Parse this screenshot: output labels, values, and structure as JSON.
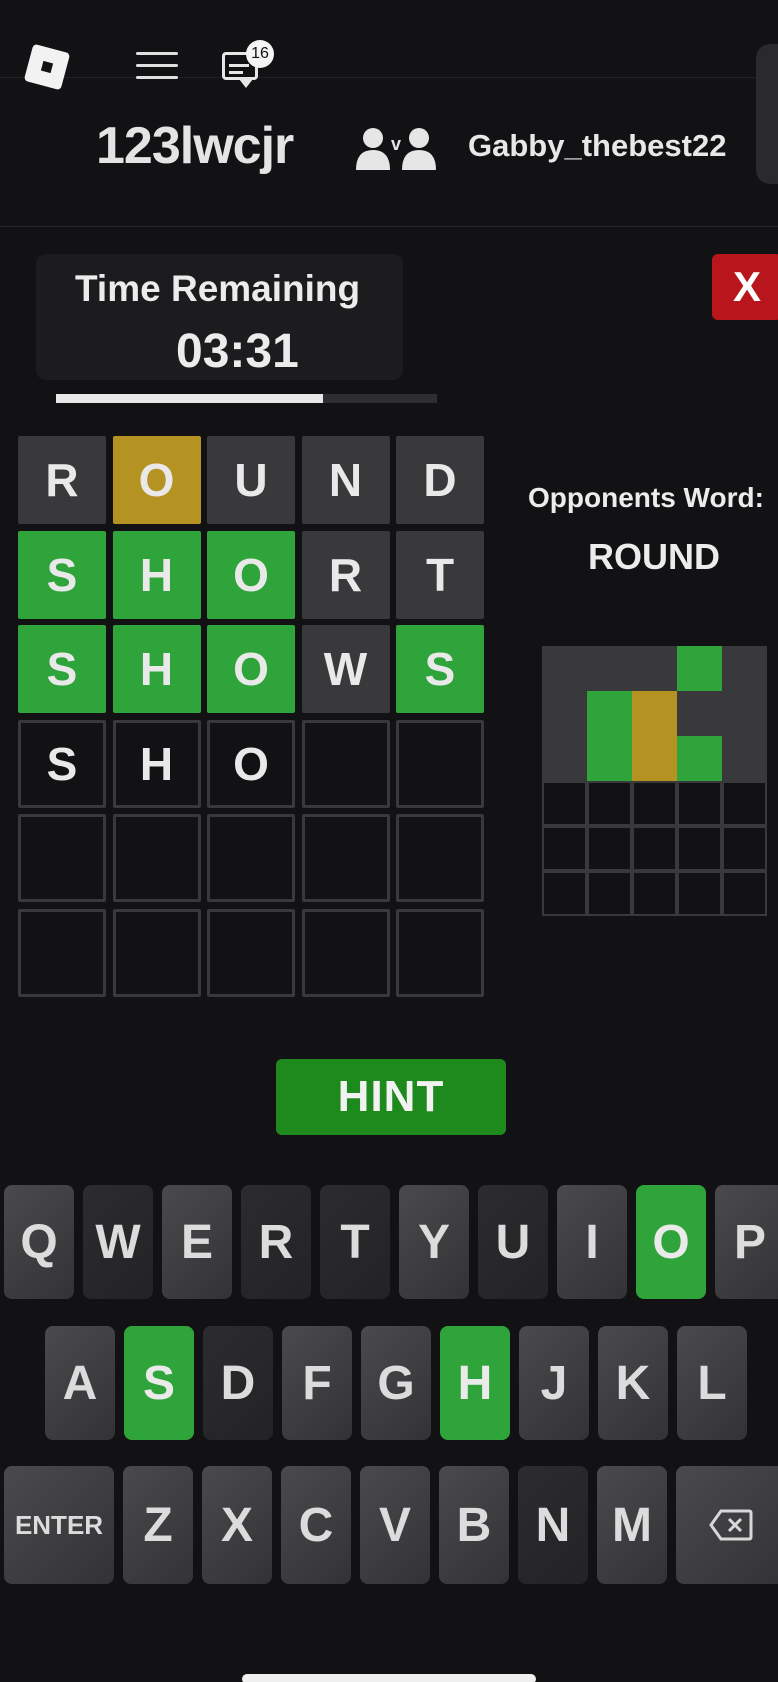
{
  "topbar": {
    "logo_icon": "roblox-logo-icon",
    "menu_icon": "hamburger-menu-icon",
    "chat_icon": "chat-icon",
    "chat_badge": "16"
  },
  "players": {
    "player1": "123lwcjr",
    "vs_icon": "versus-players-icon",
    "player2": "Gabby_thebest22"
  },
  "timer": {
    "label": "Time Remaining",
    "value": "03:31",
    "progress_fraction": 0.7
  },
  "close_button": {
    "label": "X"
  },
  "board": {
    "rows": [
      [
        {
          "letter": "R",
          "state": "absent"
        },
        {
          "letter": "O",
          "state": "present"
        },
        {
          "letter": "U",
          "state": "absent"
        },
        {
          "letter": "N",
          "state": "absent"
        },
        {
          "letter": "D",
          "state": "absent"
        }
      ],
      [
        {
          "letter": "S",
          "state": "correct"
        },
        {
          "letter": "H",
          "state": "correct"
        },
        {
          "letter": "O",
          "state": "correct"
        },
        {
          "letter": "R",
          "state": "absent"
        },
        {
          "letter": "T",
          "state": "absent"
        }
      ],
      [
        {
          "letter": "S",
          "state": "correct"
        },
        {
          "letter": "H",
          "state": "correct"
        },
        {
          "letter": "O",
          "state": "correct"
        },
        {
          "letter": "W",
          "state": "absent"
        },
        {
          "letter": "S",
          "state": "correct"
        }
      ],
      [
        {
          "letter": "S",
          "state": "empty"
        },
        {
          "letter": "H",
          "state": "empty"
        },
        {
          "letter": "O",
          "state": "empty"
        },
        {
          "letter": "",
          "state": "empty"
        },
        {
          "letter": "",
          "state": "empty"
        }
      ],
      [
        {
          "letter": "",
          "state": "empty"
        },
        {
          "letter": "",
          "state": "empty"
        },
        {
          "letter": "",
          "state": "empty"
        },
        {
          "letter": "",
          "state": "empty"
        },
        {
          "letter": "",
          "state": "empty"
        }
      ],
      [
        {
          "letter": "",
          "state": "empty"
        },
        {
          "letter": "",
          "state": "empty"
        },
        {
          "letter": "",
          "state": "empty"
        },
        {
          "letter": "",
          "state": "empty"
        },
        {
          "letter": "",
          "state": "empty"
        }
      ]
    ]
  },
  "opponent": {
    "label": "Opponents Word:",
    "word": "ROUND",
    "rows": [
      [
        "absent",
        "absent",
        "absent",
        "correct",
        "absent"
      ],
      [
        "absent",
        "correct",
        "present",
        "absent",
        "absent"
      ],
      [
        "absent",
        "correct",
        "present",
        "correct",
        "absent"
      ],
      [
        "empty",
        "empty",
        "empty",
        "empty",
        "empty"
      ],
      [
        "empty",
        "empty",
        "empty",
        "empty",
        "empty"
      ],
      [
        "empty",
        "empty",
        "empty",
        "empty",
        "empty"
      ]
    ]
  },
  "hint_button": {
    "label": "HINT"
  },
  "keyboard": {
    "row1": [
      {
        "k": "Q",
        "s": "normal"
      },
      {
        "k": "W",
        "s": "dark"
      },
      {
        "k": "E",
        "s": "normal"
      },
      {
        "k": "R",
        "s": "dark"
      },
      {
        "k": "T",
        "s": "dark"
      },
      {
        "k": "Y",
        "s": "normal"
      },
      {
        "k": "U",
        "s": "dark"
      },
      {
        "k": "I",
        "s": "normal"
      },
      {
        "k": "O",
        "s": "correct"
      },
      {
        "k": "P",
        "s": "normal"
      }
    ],
    "row2": [
      {
        "k": "A",
        "s": "normal"
      },
      {
        "k": "S",
        "s": "correct"
      },
      {
        "k": "D",
        "s": "dark"
      },
      {
        "k": "F",
        "s": "normal"
      },
      {
        "k": "G",
        "s": "normal"
      },
      {
        "k": "H",
        "s": "correct"
      },
      {
        "k": "J",
        "s": "normal"
      },
      {
        "k": "K",
        "s": "normal"
      },
      {
        "k": "L",
        "s": "normal"
      }
    ],
    "row3": [
      {
        "k": "ENTER",
        "s": "normal"
      },
      {
        "k": "Z",
        "s": "normal"
      },
      {
        "k": "X",
        "s": "normal"
      },
      {
        "k": "C",
        "s": "normal"
      },
      {
        "k": "V",
        "s": "normal"
      },
      {
        "k": "B",
        "s": "normal"
      },
      {
        "k": "N",
        "s": "dark"
      },
      {
        "k": "M",
        "s": "normal"
      },
      {
        "k": "",
        "s": "normal",
        "icon": "backspace-icon"
      }
    ]
  },
  "colors": {
    "background": "#121214",
    "correct": "#2fa43a",
    "present": "#b59323",
    "absent": "#39393c",
    "close": "#b8161c",
    "hint": "#1e8a1e"
  }
}
